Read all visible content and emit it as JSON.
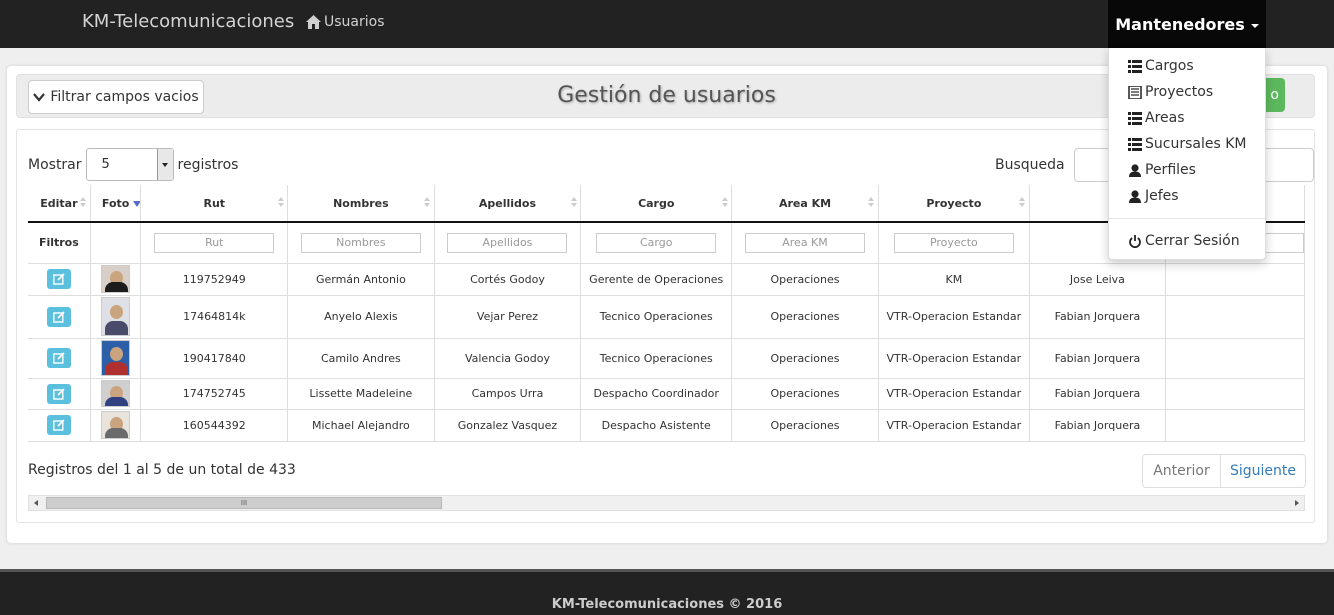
{
  "navbar": {
    "brand": "KM-Telecomunicaciones",
    "users_link": "Usuarios",
    "menu_label": "Mantenedores"
  },
  "dropdown": {
    "items": [
      {
        "label": "Cargos",
        "icon": "list-icon"
      },
      {
        "label": "Proyectos",
        "icon": "document-icon"
      },
      {
        "label": "Areas",
        "icon": "list-icon"
      },
      {
        "label": "Sucursales KM",
        "icon": "list-icon"
      },
      {
        "label": "Perfiles",
        "icon": "user-icon"
      },
      {
        "label": "Jefes",
        "icon": "user-icon"
      }
    ],
    "logout": "Cerrar Sesión"
  },
  "header": {
    "filter_button": "Filtrar campos vacios",
    "title": "Gestión de usuarios",
    "green_button_partial": "o"
  },
  "controls": {
    "show_label": "Mostrar",
    "show_value": "5",
    "records_label": "registros",
    "search_label": "Busqueda"
  },
  "table": {
    "columns": [
      "Editar",
      "Foto",
      "Rut",
      "Nombres",
      "Apellidos",
      "Cargo",
      "Area KM",
      "Proyecto",
      "",
      ""
    ],
    "filter_label": "Filtros",
    "filter_placeholders": [
      "Rut",
      "Nombres",
      "Apellidos",
      "Cargo",
      "Area KM",
      "Proyecto"
    ],
    "rows": [
      {
        "rut": "119752949",
        "nombres": "Germán Antonio",
        "apellidos": "Cortés Godoy",
        "cargo": "Gerente de Operaciones",
        "area": "Operaciones",
        "proyecto": "KM",
        "jefe": "Jose Leiva"
      },
      {
        "rut": "17464814k",
        "nombres": "Anyelo Alexis",
        "apellidos": "Vejar Perez",
        "cargo": "Tecnico Operaciones",
        "area": "Operaciones",
        "proyecto": "VTR-Operacion Estandar",
        "jefe": "Fabian Jorquera"
      },
      {
        "rut": "190417840",
        "nombres": "Camilo Andres",
        "apellidos": "Valencia Godoy",
        "cargo": "Tecnico Operaciones",
        "area": "Operaciones",
        "proyecto": "VTR-Operacion Estandar",
        "jefe": "Fabian Jorquera"
      },
      {
        "rut": "174752745",
        "nombres": "Lissette Madeleine",
        "apellidos": "Campos Urra",
        "cargo": "Despacho Coordinador",
        "area": "Operaciones",
        "proyecto": "VTR-Operacion Estandar",
        "jefe": "Fabian Jorquera"
      },
      {
        "rut": "160544392",
        "nombres": "Michael Alejandro",
        "apellidos": "Gonzalez Vasquez",
        "cargo": "Despacho Asistente",
        "area": "Operaciones",
        "proyecto": "VTR-Operacion Estandar",
        "jefe": "Fabian Jorquera"
      }
    ]
  },
  "pagination": {
    "info": "Registros del 1 al 5 de un total de 433",
    "prev": "Anterior",
    "next": "Siguiente"
  },
  "scrollbar": {
    "thumb_grip": "III"
  },
  "footer": {
    "text": "KM-Telecomunicaciones © 2016"
  },
  "colors": {
    "navbar": "#222222",
    "edit_button": "#5bc0de",
    "green_button": "#5cb85c",
    "link": "#337ab7"
  }
}
